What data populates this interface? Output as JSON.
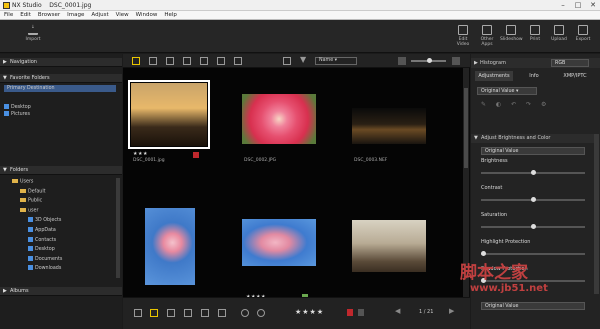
{
  "window": {
    "app": "NX Studio",
    "file": "DSC_0001.jpg",
    "controls": [
      "–",
      "□",
      "✕"
    ]
  },
  "menu": [
    "File",
    "Edit",
    "Browser",
    "Image",
    "Adjust",
    "View",
    "Window",
    "Help"
  ],
  "toolbar": {
    "import": "Import",
    "right_buttons": [
      "Edit Video",
      "Other Apps",
      "Slideshow",
      "Print",
      "Upload",
      "Export"
    ]
  },
  "left_panel": {
    "navigation": "Navigation",
    "favorites": "Favorite Folders",
    "primary": "Primary Destination",
    "favorite_items": [
      "Desktop",
      "Pictures"
    ],
    "folders": "Folders",
    "tree": [
      {
        "label": "Users",
        "indent": 1
      },
      {
        "label": "Default",
        "indent": 2
      },
      {
        "label": "Public",
        "indent": 2
      },
      {
        "label": "user",
        "indent": 2
      },
      {
        "label": "3D Objects",
        "indent": 3
      },
      {
        "label": "AppData",
        "indent": 3
      },
      {
        "label": "Contacts",
        "indent": 3
      },
      {
        "label": "Desktop",
        "indent": 3
      },
      {
        "label": "Documents",
        "indent": 3
      },
      {
        "label": "Downloads",
        "indent": 3
      }
    ],
    "albums": "Albums"
  },
  "browser": {
    "sort": "Name",
    "thumbnails": [
      {
        "name": "DSC_0001.jpg",
        "stars": "★★★",
        "flag": "red",
        "kind": "sunset"
      },
      {
        "name": "DSC_0002.JPG",
        "stars": "",
        "flag": "",
        "kind": "dahlia"
      },
      {
        "name": "DSC_0003.NEF",
        "stars": "",
        "flag": "",
        "kind": "night"
      },
      {
        "name": "",
        "stars": "",
        "flag": "",
        "kind": "blossom_v"
      },
      {
        "name": "",
        "stars": "★★★★",
        "flag": "green",
        "kind": "blossom_h"
      },
      {
        "name": "",
        "stars": "",
        "flag": "",
        "kind": "cat"
      }
    ],
    "bottom_stars": "★★★★",
    "page": "1 / 21"
  },
  "right_panel": {
    "histogram": "Histogram",
    "histogram_mode": "RGB",
    "tabs": [
      "Adjustments",
      "Info",
      "XMP/IPTC"
    ],
    "preset": "Original Value",
    "section": "Adjust Brightness and Color",
    "section_preset": "Original Value",
    "sliders": [
      {
        "label": "Brightness",
        "value": 0.5
      },
      {
        "label": "Contrast",
        "value": 0.5
      },
      {
        "label": "Saturation",
        "value": 0.5
      },
      {
        "label": "Highlight Protection",
        "value": 0.0
      },
      {
        "label": "Shadow Protection",
        "value": 0.0
      }
    ],
    "bottom_preset": "Original Value"
  },
  "watermark": {
    "title": "脚本之家",
    "url": "www.jb51.net"
  }
}
